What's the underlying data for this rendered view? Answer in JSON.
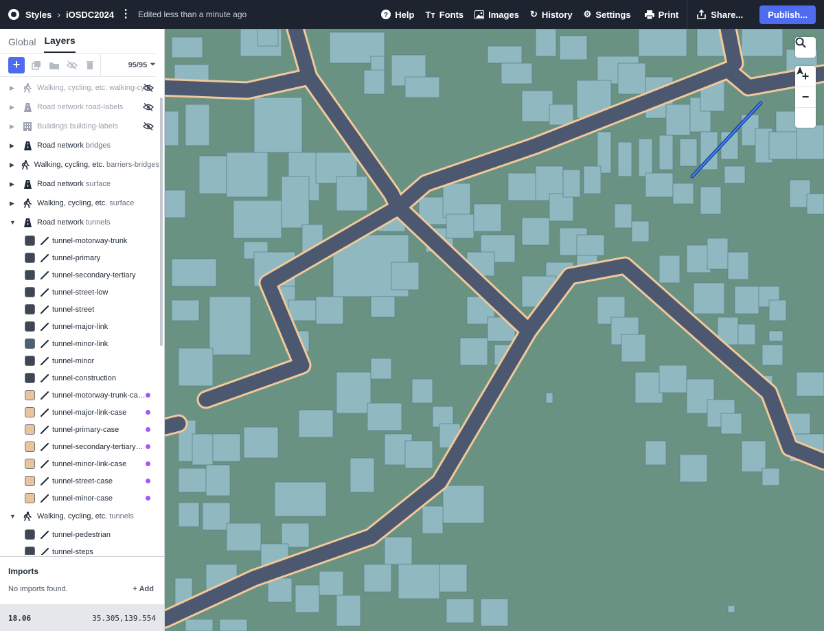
{
  "topbar": {
    "styles_label": "Styles",
    "style_name": "iOSDC2024",
    "edited": "Edited less than a minute ago",
    "nav": [
      {
        "label": "Help",
        "icon": "help-icon"
      },
      {
        "label": "Fonts",
        "icon": "fonts-icon"
      },
      {
        "label": "Images",
        "icon": "images-icon"
      },
      {
        "label": "History",
        "icon": "history-icon"
      },
      {
        "label": "Settings",
        "icon": "settings-icon"
      },
      {
        "label": "Print",
        "icon": "print-icon"
      }
    ],
    "share_label": "Share...",
    "publish_label": "Publish..."
  },
  "sidebar": {
    "tabs": [
      "Global",
      "Layers"
    ],
    "active_tab": "Layers",
    "count": "95/95",
    "groups_top": [
      {
        "name": "Walking, cycling, etc.",
        "source": "walking-cycli",
        "icon": "walking-icon",
        "hidden": true
      },
      {
        "name": "Road network",
        "source": "road-labels",
        "icon": "road-icon",
        "hidden": true
      },
      {
        "name": "Buildings",
        "source": "building-labels",
        "icon": "building-icon",
        "hidden": true
      },
      {
        "name": "Road network",
        "source": "bridges",
        "icon": "road-icon",
        "hidden": false
      },
      {
        "name": "Walking, cycling, etc.",
        "source": "barriers-bridges",
        "icon": "walking-icon",
        "hidden": false
      },
      {
        "name": "Road network",
        "source": "surface",
        "icon": "road-icon",
        "hidden": false
      },
      {
        "name": "Walking, cycling, etc.",
        "source": "surface",
        "icon": "walking-icon",
        "hidden": false
      },
      {
        "name": "Road network",
        "source": "tunnels",
        "icon": "road-icon",
        "hidden": false,
        "expanded": true
      }
    ],
    "tunnel_layers": [
      {
        "name": "tunnel-motorway-trunk",
        "color": "#3f4754",
        "dot": false
      },
      {
        "name": "tunnel-primary",
        "color": "#3f4754",
        "dot": false
      },
      {
        "name": "tunnel-secondary-tertiary",
        "color": "#3f4754",
        "dot": false
      },
      {
        "name": "tunnel-street-low",
        "color": "#3f4754",
        "dot": false
      },
      {
        "name": "tunnel-street",
        "color": "#3f4754",
        "dot": false
      },
      {
        "name": "tunnel-major-link",
        "color": "#3f4754",
        "dot": false
      },
      {
        "name": "tunnel-minor-link",
        "color": "#4e5f76",
        "dot": false
      },
      {
        "name": "tunnel-minor",
        "color": "#3f4754",
        "dot": false
      },
      {
        "name": "tunnel-construction",
        "color": "#3f4754",
        "dot": false
      },
      {
        "name": "tunnel-motorway-trunk-case",
        "color": "#e9c49c",
        "dot": true
      },
      {
        "name": "tunnel-major-link-case",
        "color": "#e9c49c",
        "dot": true
      },
      {
        "name": "tunnel-primary-case",
        "color": "#e9c49c",
        "dot": true
      },
      {
        "name": "tunnel-secondary-tertiary-c...",
        "color": "#e9c49c",
        "dot": true
      },
      {
        "name": "tunnel-minor-link-case",
        "color": "#e9c49c",
        "dot": true
      },
      {
        "name": "tunnel-street-case",
        "color": "#e9c49c",
        "dot": true
      },
      {
        "name": "tunnel-minor-case",
        "color": "#e9c49c",
        "dot": true
      }
    ],
    "group_walking_tunnels": {
      "name": "Walking, cycling, etc.",
      "source": "tunnels",
      "icon": "walking-icon",
      "expanded": true
    },
    "walking_tunnel_layers": [
      {
        "name": "tunnel-pedestrian",
        "color": "#3f4754"
      },
      {
        "name": "tunnel-steps",
        "color": "#3f4754"
      }
    ],
    "imports": {
      "title": "Imports",
      "empty": "No imports found.",
      "add_label": "Add"
    },
    "status": {
      "zoom": "18.06",
      "coords": "35.305,139.554"
    }
  },
  "colors": {
    "accent": "#4f6cf0",
    "land": "#6a9282",
    "building": "#8fb8c0",
    "road": "#4c5870",
    "road_case": "#f2c89a"
  }
}
